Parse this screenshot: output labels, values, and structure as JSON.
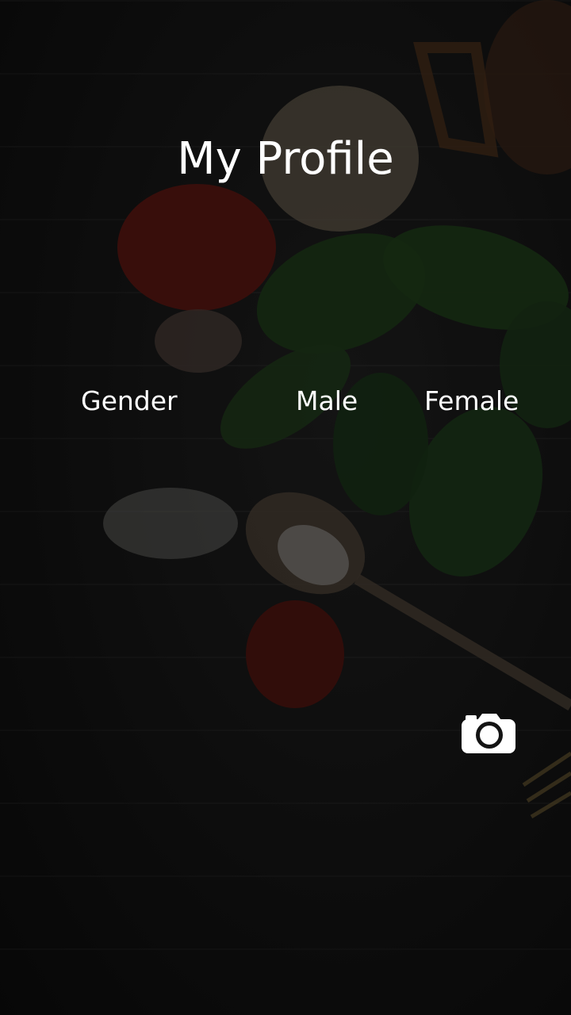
{
  "header": {
    "title": "My Profile"
  },
  "gender": {
    "label": "Gender",
    "options": [
      "Male",
      "Female"
    ]
  },
  "actions": {
    "camera_icon": "camera-icon"
  },
  "colors": {
    "text": "#ffffff",
    "background": "#121212"
  }
}
